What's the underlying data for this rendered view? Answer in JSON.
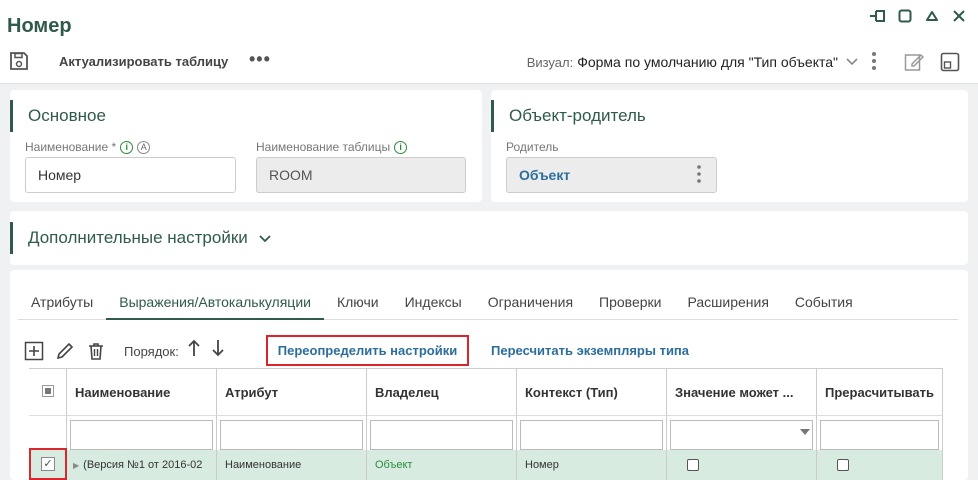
{
  "window": {
    "title": "Номер",
    "controls": [
      "pin",
      "maximize",
      "collapse",
      "close"
    ]
  },
  "toolbar": {
    "refresh_label": "Актуализировать таблицу",
    "more": "•••",
    "visual_label": "Визуал:",
    "visual_value": "Форма по умолчанию для \"Тип объекта\""
  },
  "main_panel": {
    "title": "Основное",
    "name_label": "Наименование *",
    "name_value": "Номер",
    "table_name_label": "Наименование таблицы",
    "table_name_value": "ROOM"
  },
  "parent_panel": {
    "title": "Объект-родитель",
    "parent_label": "Родитель",
    "parent_value": "Объект"
  },
  "extra_panel": {
    "title": "Дополнительные настройки"
  },
  "tabs": {
    "items": [
      "Атрибуты",
      "Выражения/Автокалькуляции",
      "Ключи",
      "Индексы",
      "Ограничения",
      "Проверки",
      "Расширения",
      "События"
    ],
    "active_index": 1
  },
  "grid_toolbar": {
    "order_label": "Порядок:",
    "redefine_label": "Переопределить настройки",
    "recalc_label": "Пересчитать экземпляры типа"
  },
  "grid": {
    "columns": [
      "Наименование",
      "Атрибут",
      "Владелец",
      "Контекст (Тип)",
      "Значение может ...",
      "Прерасчитывать"
    ],
    "rows": [
      {
        "name": "(Версия №1 от 2016-02",
        "attribute": "Наименование",
        "owner": "Объект",
        "context": "Номер",
        "nullable": false,
        "recalc": false,
        "selected": true
      }
    ]
  },
  "colors": {
    "accent": "#2f5a4c",
    "link": "#2c6e9b",
    "highlight_border": "#d9262c",
    "selected_row": "#d7ebe0"
  }
}
